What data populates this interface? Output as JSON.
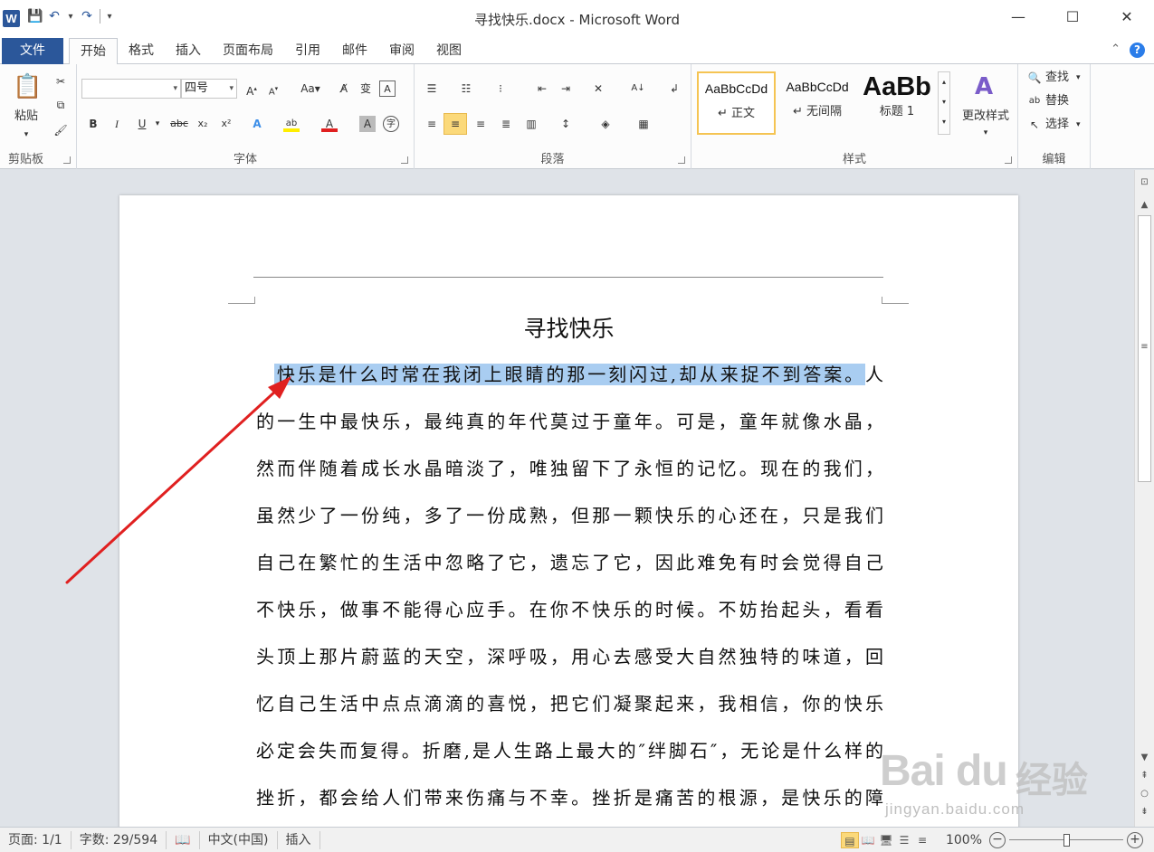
{
  "window": {
    "title": "寻找快乐.docx - Microsoft Word",
    "app_icon": "W",
    "controls": [
      "—",
      "☐",
      "✕"
    ]
  },
  "tabs": {
    "file": "文件",
    "items": [
      "开始",
      "格式",
      "插入",
      "页面布局",
      "引用",
      "邮件",
      "审阅",
      "视图"
    ],
    "active": "开始"
  },
  "ribbon": {
    "clipboard": {
      "label": "剪贴板",
      "paste": "粘贴"
    },
    "font": {
      "label": "字体",
      "font_name": "",
      "font_size": "四号"
    },
    "paragraph": {
      "label": "段落"
    },
    "styles": {
      "label": "样式",
      "items": [
        {
          "sample": "AaBbCcDd",
          "name": "↵ 正文"
        },
        {
          "sample": "AaBbCcDd",
          "name": "↵ 无间隔"
        },
        {
          "sample": "AaBb",
          "name": "标题 1"
        }
      ],
      "change_styles": "更改样式"
    },
    "editing": {
      "label": "编辑",
      "find": "查找",
      "replace": "替换",
      "select": "选择"
    }
  },
  "document": {
    "title": "寻找快乐",
    "selected_text": "快乐是什么时常在我闭上眼睛的那一刻闪过,却从来捉不到答案。",
    "lines": [
      "人",
      "的一生中最快乐，最纯真的年代莫过于童年。可是，童年就像水晶，",
      "然而伴随着成长水晶暗淡了，唯独留下了永恒的记忆。现在的我们，",
      "虽然少了一份纯，多了一份成熟，但那一颗快乐的心还在，只是我们",
      "自己在繁忙的生活中忽略了它，遗忘了它，因此难免有时会觉得自己",
      "不快乐，做事不能得心应手。在你不快乐的时候。不妨抬起头，看看",
      "头顶上那片蔚蓝的天空，深呼吸，用心去感受大自然独特的味道，回",
      "忆自己生活中点点滴滴的喜悦，把它们凝聚起来，我相信，你的快乐",
      "必定会失而复得。折磨,是人生路上最大的″绊脚石″，无论是什么样的",
      "挫折，都会给人们带来伤痛与不幸。挫折是痛苦的根源，是快乐的障"
    ]
  },
  "statusbar": {
    "page": "页面: 1/1",
    "words": "字数: 29/594",
    "language": "中文(中国)",
    "mode": "插入",
    "zoom": "100%",
    "zoom_level": 1.0
  },
  "watermark": {
    "brand": "Bai du",
    "cn": "经验",
    "url": "jingyan.baidu.com"
  },
  "colors": {
    "accent": "#2b579a",
    "selection": "#a9cdf1",
    "arrow": "#e02020"
  }
}
